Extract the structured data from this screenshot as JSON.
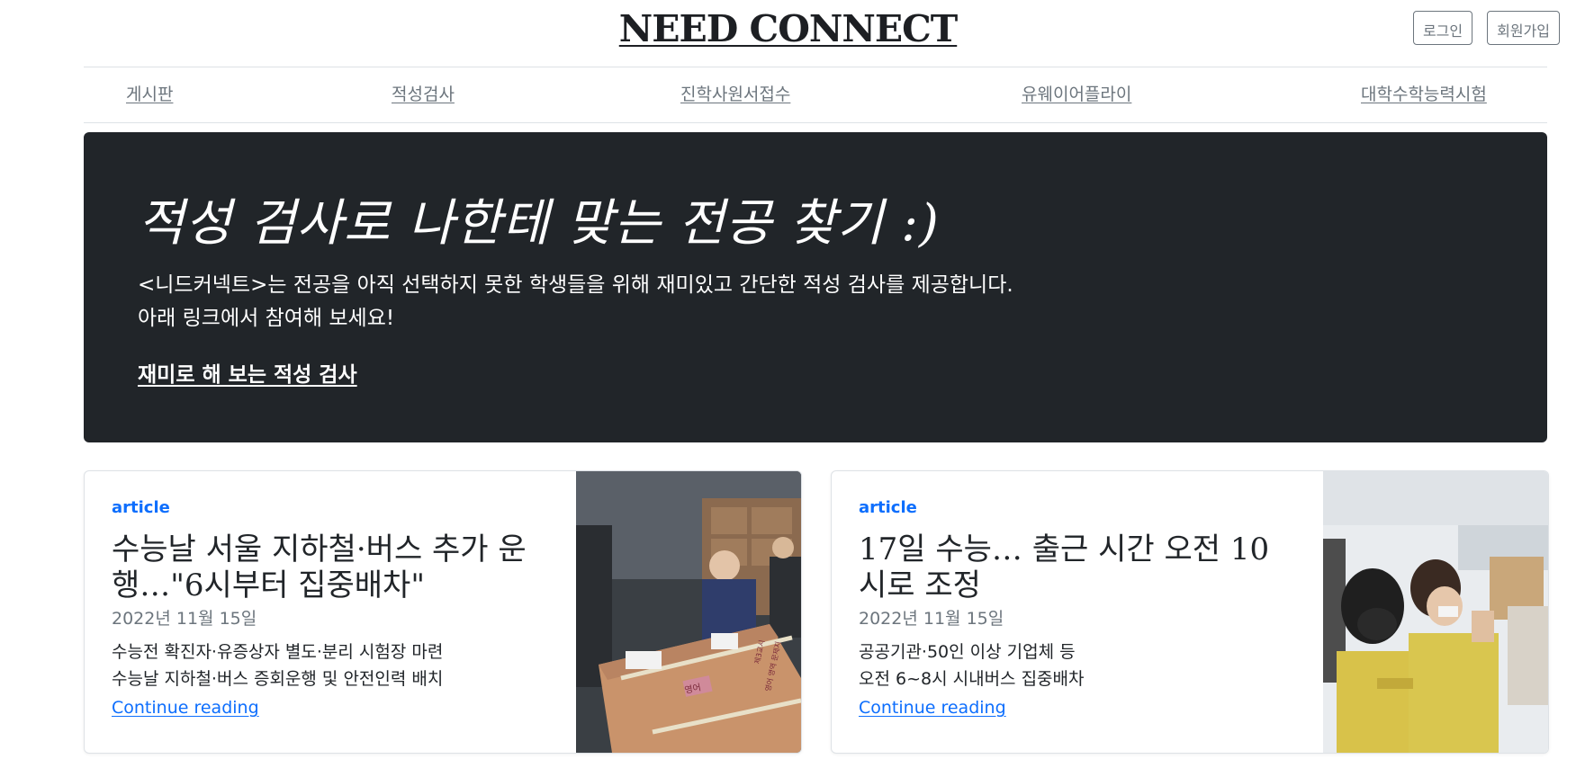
{
  "header": {
    "brand": "NEED CONNECT",
    "login_label": "로그인",
    "signup_label": "회원가입"
  },
  "nav": {
    "items": [
      {
        "label": "게시판"
      },
      {
        "label": "적성검사"
      },
      {
        "label": "진학사원서접수"
      },
      {
        "label": "유웨이어플라이"
      },
      {
        "label": "대학수학능력시험"
      }
    ]
  },
  "hero": {
    "title": "적성 검사로 나한테 맞는 전공 찾기 :)",
    "line1": "<니드커넥트>는 전공을 아직 선택하지 못한 학생들을 위해 재미있고 간단한 적성 검사를 제공합니다.",
    "line2": "아래 링크에서 참여해 보세요!",
    "link_label": "재미로 해 보는 적성 검사"
  },
  "cards": [
    {
      "category": "article",
      "title": "수능날 서울 지하철·버스 추가 운행…\"6시부터 집중배차\"",
      "date": "2022년 11월 15일",
      "summary_line1": "수능전 확진자·유증상자 별도·분리 시험장 마련",
      "summary_line2": "수능날 지하철·버스 증회운행 및 안전인력 배치",
      "link_label": "Continue reading",
      "box_labels": [
        "영어",
        "제3교시",
        "영어 영역 문제지"
      ]
    },
    {
      "category": "article",
      "title": "17일 수능… 출근 시간 오전 10시로 조정",
      "date": "2022년 11월 15일",
      "summary_line1": "공공기관·50인 이상 기업체 등",
      "summary_line2": "오전 6~8시 시내버스 집중배차",
      "link_label": "Continue reading"
    }
  ],
  "colors": {
    "hero_bg": "#212529",
    "accent": "#0d6efd",
    "muted": "#6c757d"
  }
}
